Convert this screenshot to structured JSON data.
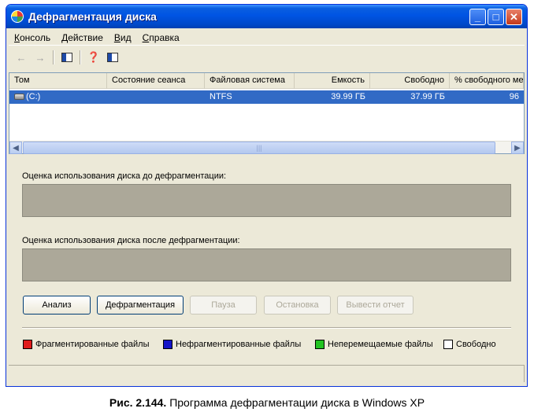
{
  "window": {
    "title": "Дефрагментация диска",
    "controls": {
      "minimize": "_",
      "maximize": "□",
      "close": "✕"
    }
  },
  "menu": [
    {
      "accel": "К",
      "rest": "онсоль"
    },
    {
      "accel": "Д",
      "rest": "ействие"
    },
    {
      "accel": "В",
      "rest": "ид"
    },
    {
      "accel": "С",
      "rest": "правка"
    }
  ],
  "toolbar": {
    "icons": [
      "back-arrow-icon",
      "forward-arrow-icon",
      "show-hide-tree-icon",
      "help-icon",
      "properties-icon"
    ]
  },
  "volumes": {
    "columns": [
      "Том",
      "Состояние сеанса",
      "Файловая система",
      "Емкость",
      "Свободно",
      "% свободного ме"
    ],
    "rows": [
      {
        "volume": "(C:)",
        "status": "",
        "fs": "NTFS",
        "capacity": "39.99 ГБ",
        "free": "37.99 ГБ",
        "free_pct": "96"
      }
    ]
  },
  "analysis": {
    "before_label": "Оценка использования диска до дефрагментации:",
    "after_label": "Оценка использования диска после дефрагментации:"
  },
  "buttons": {
    "analyze": "Анализ",
    "defragment": "Дефрагментация",
    "pause": "Пауза",
    "stop": "Остановка",
    "report": "Вывести отчет"
  },
  "legend": [
    {
      "label": "Фрагментированные файлы",
      "color": "#e01b1b"
    },
    {
      "label": "Нефрагментированные файлы",
      "color": "#1414c8"
    },
    {
      "label": "Неперемещаемые файлы",
      "color": "#22c322"
    },
    {
      "label": "Свободно",
      "color": "#ffffff"
    }
  ],
  "caption": {
    "figure": "Рис. 2.144.",
    "text": " Программа дефрагментации диска в Windows XP"
  },
  "colors": {
    "titlebar": "#0054e3",
    "selection": "#316ac5",
    "face": "#ece9d8"
  }
}
